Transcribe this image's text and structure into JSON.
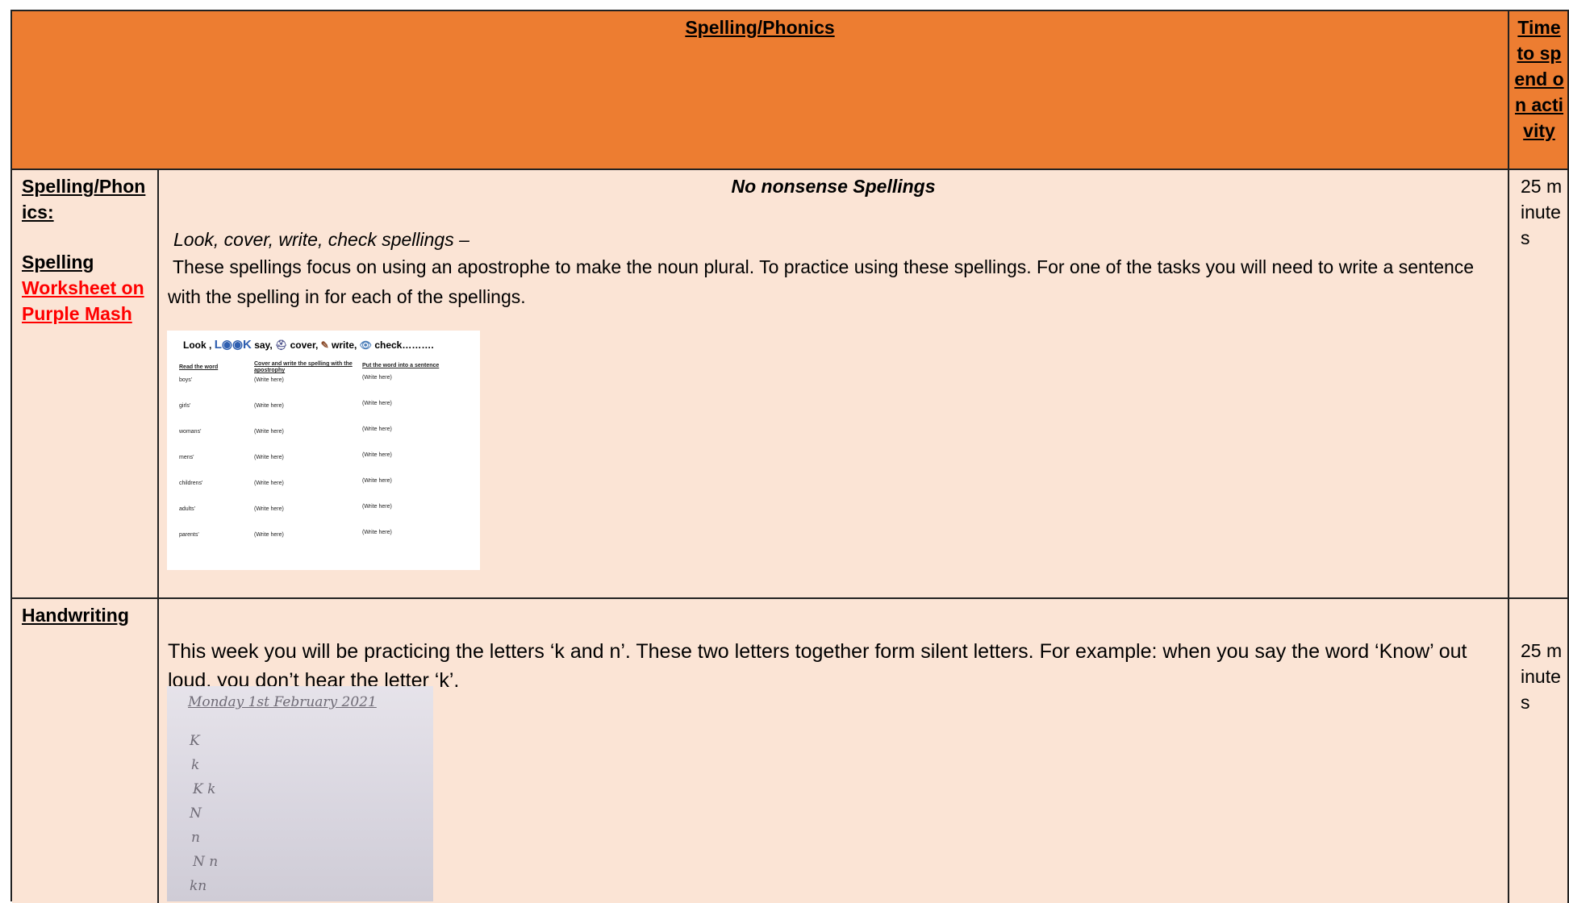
{
  "header": {
    "title": "Spelling/Phonics",
    "time_header": "Time to spend on activity"
  },
  "row1": {
    "left_heading": "Spelling/Phonics:",
    "left_sub": "Spelling",
    "left_link": "Worksheet on Purple Mash",
    "center_title": "No nonsense Spellings",
    "instruction_italic": "Look, cover, write, check spellings –",
    "instruction_body": "These spellings focus on using an apostrophe to make the noun plural. To practice using these spellings. For one of the tasks you will need to write a sentence with the spelling in for each of the spellings.",
    "time": "25 minutes",
    "worksheet": {
      "title_look": "Look ,",
      "title_say": "say,",
      "title_cover": "cover,",
      "title_write": "write,",
      "title_check": "check……….",
      "col1": "Read the word",
      "col2": "Cover and write the spelling with the apostrophy",
      "col3": "Put the word into a sentence",
      "placeholder": "(Write here)",
      "words": [
        "boys'",
        "girls'",
        "womans'",
        "mens'",
        "childrens'",
        "adults'",
        "parents'"
      ]
    }
  },
  "row2": {
    "left_heading": "Handwriting",
    "body": "This week you will be practicing the letters ‘k and n’. These two letters together form silent letters. For example: when you say the word ‘Know’ out loud, you don’t hear the letter ‘k’.",
    "time": "25 minutes",
    "image": {
      "date": "Monday 1st February 2021",
      "lines": [
        "K",
        "k",
        "K k",
        "N",
        "n",
        "N n",
        "kn"
      ]
    }
  }
}
